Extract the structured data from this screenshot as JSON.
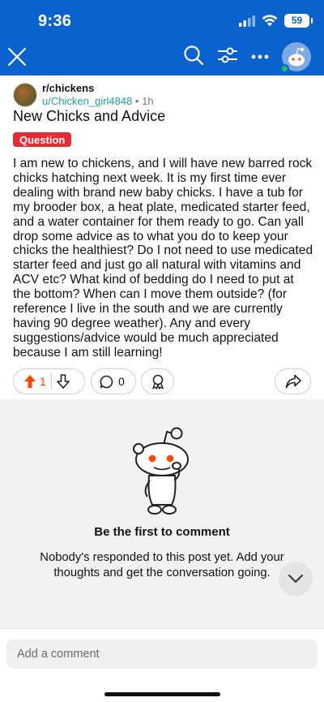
{
  "status_bar": {
    "time": "9:36",
    "battery": "59"
  },
  "nav": {
    "close": "close-icon",
    "search": "search-icon",
    "sort": "sort-filter-icon",
    "more": "more-icon",
    "profile": "avatar"
  },
  "post": {
    "subreddit": "r/chickens",
    "author": "u/Chicken_girl4848",
    "separator": "•",
    "age": "1h",
    "title": "New Chicks and Advice",
    "flair": "Question",
    "body": "I am new to chickens, and I will have new barred rock chicks hatching next week. It is my first time ever dealing with brand new baby chicks. I have a tub for my brooder box, a heat plate, medicated starter feed, and a water container for them ready to go. Can yall drop some advice as to what you do to keep your chicks the healthiest? Do I not need to use medicated starter feed and just go all natural with vitamins and ACV etc? What kind of bedding do I need to put at the bottom? When can I move them outside? (for reference I live in the south and we are currently having 90 degree weather). Any and every suggestions/advice would be much appreciated because I am still learning!",
    "vote_count": "1",
    "comment_count": "0"
  },
  "comments": {
    "empty_title": "Be the first to comment",
    "empty_desc": "Nobody's responded to this post yet. Add your thoughts and get the conversation going."
  },
  "composer": {
    "placeholder": "Add a comment"
  },
  "colors": {
    "header": "#0a62ce",
    "upvote": "#ff4500",
    "flair": "#e52c36",
    "author": "#1a9fb0"
  }
}
